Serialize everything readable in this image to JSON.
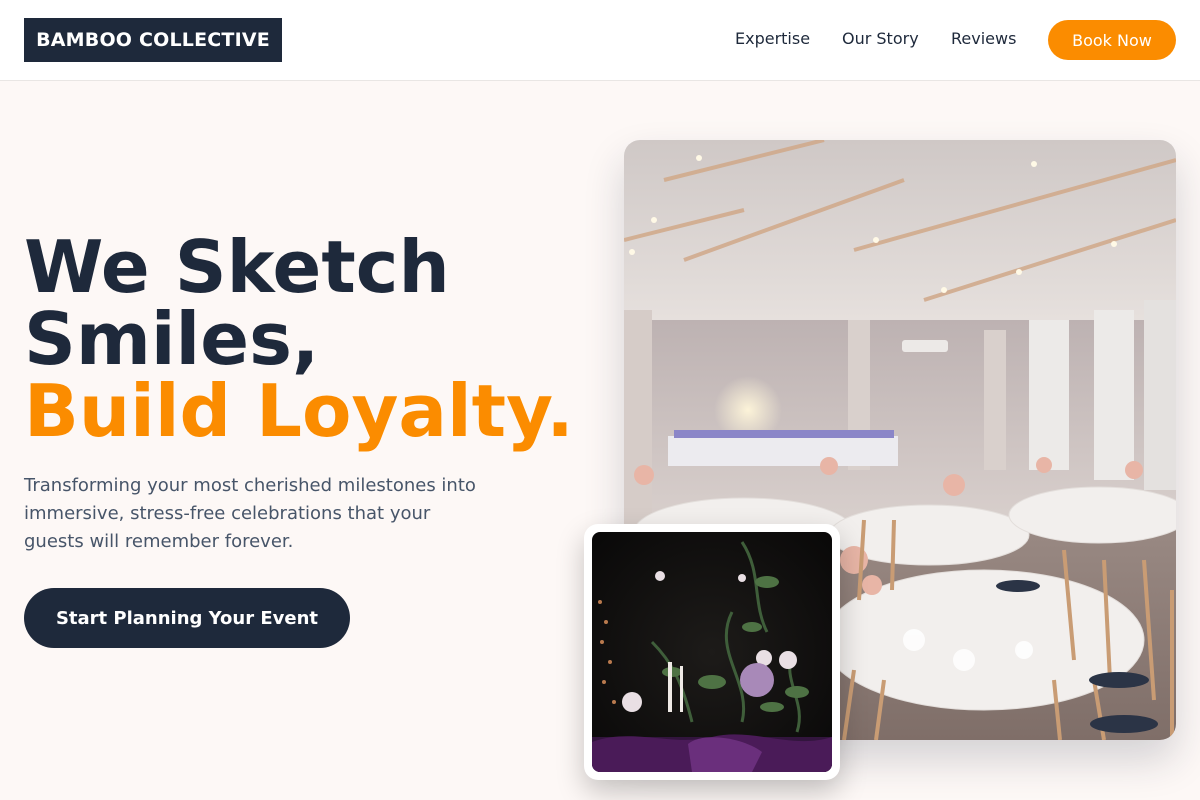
{
  "brand": {
    "name": "BAMBOO COLLECTIVE"
  },
  "nav": {
    "links": [
      "Expertise",
      "Our Story",
      "Reviews"
    ],
    "cta_label": "Book Now"
  },
  "hero": {
    "headline_line1": "We Sketch",
    "headline_line2": "Smiles,",
    "headline_accent": "Build Loyalty.",
    "subtext": "Transforming your most cherished milestones into immersive, stress-free celebrations that your guests will remember forever.",
    "cta_label": "Start Planning Your Event"
  },
  "colors": {
    "primary": "#1e293b",
    "accent": "#fb8c00",
    "background": "#fdf8f6"
  },
  "images": {
    "main_photo": "banquet-hall-photo",
    "inset_photo": "floral-centerpiece-photo"
  }
}
